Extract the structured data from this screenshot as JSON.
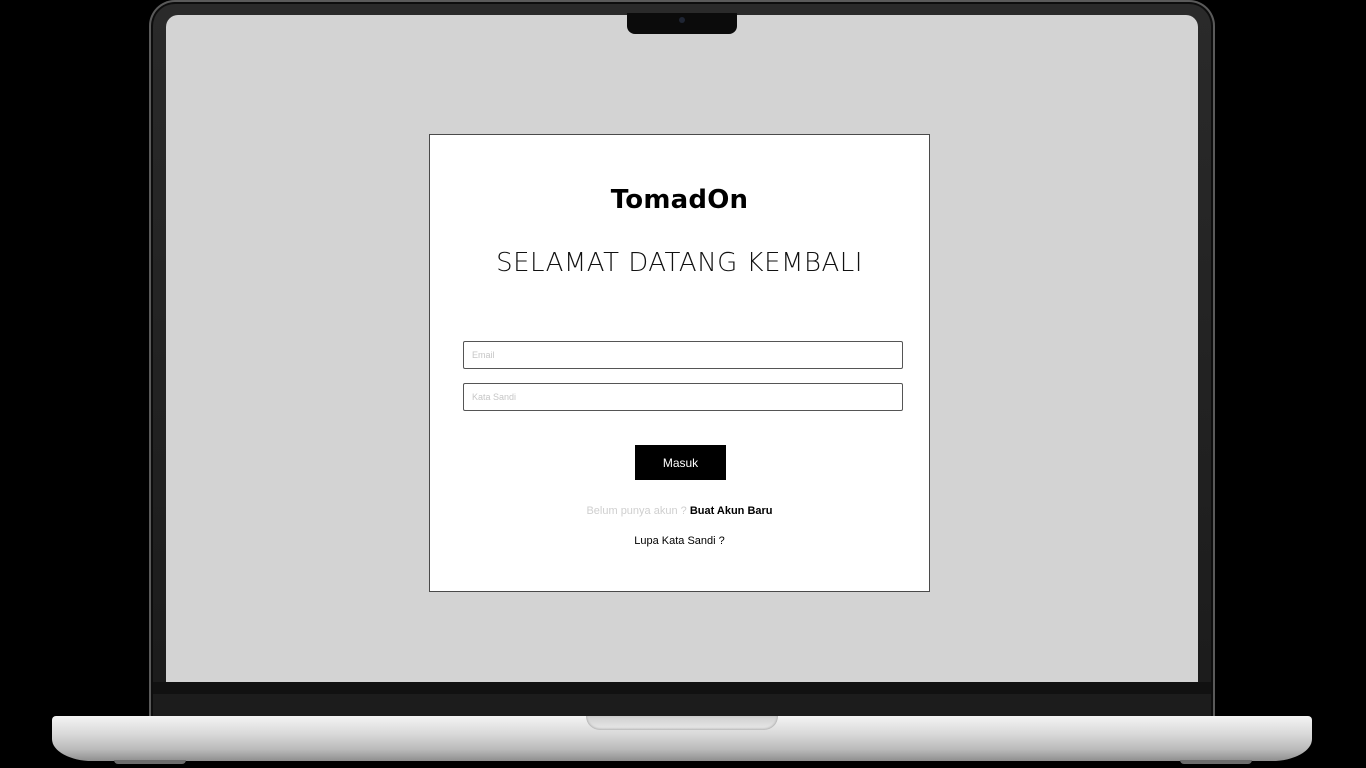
{
  "app": {
    "brand": "TomadOn",
    "heading": "SELAMAT DATANG KEMBALI"
  },
  "form": {
    "email_placeholder": "Email",
    "email_value": "",
    "password_placeholder": "Kata Sandi",
    "password_value": "",
    "submit_label": "Masuk"
  },
  "signup": {
    "prompt": "Belum punya akun ? ",
    "link_label": "Buat Akun Baru"
  },
  "forgot": {
    "link_label": "Lupa Kata Sandi ?"
  },
  "colors": {
    "screen_background": "#d3d3d3",
    "card_background": "#ffffff",
    "button_background": "#000000",
    "button_text": "#ffffff",
    "muted_text": "#cfcfcf"
  }
}
